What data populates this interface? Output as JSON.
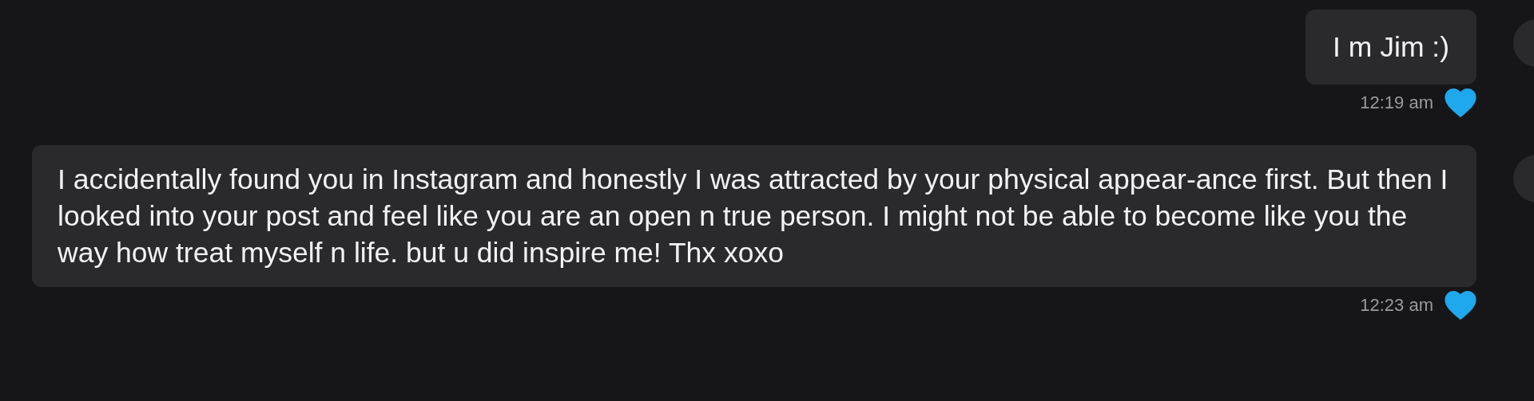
{
  "messages": [
    {
      "text": "I m Jim :)",
      "time": "12:19 am",
      "liked": true
    },
    {
      "text": "I accidentally found you in Instagram and honestly I was attracted by your physical appear-ance first. But then I looked into your post and feel like you are an open n true person. I might not be able to become like you the way how treat myself n life. but u did inspire me! Thx xoxo",
      "time": "12:23 am",
      "liked": true
    }
  ]
}
